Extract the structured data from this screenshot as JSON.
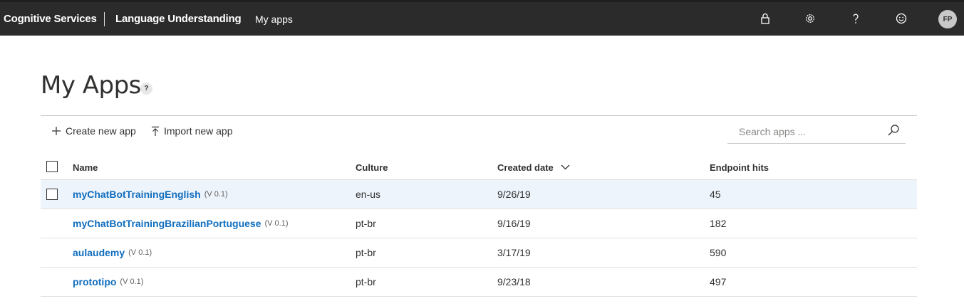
{
  "topbar": {
    "brand": "Cognitive Services",
    "product": "Language Understanding",
    "crumb": "My apps",
    "avatar_initials": "FP",
    "icons": [
      "lock-icon",
      "gear-icon",
      "help-icon",
      "smiley-icon"
    ]
  },
  "page": {
    "title": "My Apps",
    "help_glyph": "?"
  },
  "commands": {
    "create_label": "Create new app",
    "import_label": "Import new app"
  },
  "search": {
    "placeholder": "Search apps ...",
    "value": ""
  },
  "table": {
    "headers": {
      "name": "Name",
      "culture": "Culture",
      "created": "Created date",
      "hits": "Endpoint hits"
    },
    "sort": {
      "column": "created",
      "direction": "descending"
    },
    "rows": [
      {
        "name": "myChatBotTrainingEnglish",
        "version": "(V 0.1)",
        "culture": "en-us",
        "created": "9/26/19",
        "hits": "45",
        "selected": true
      },
      {
        "name": "myChatBotTrainingBrazilianPortuguese",
        "version": "(V 0.1)",
        "culture": "pt-br",
        "created": "9/16/19",
        "hits": "182",
        "selected": false
      },
      {
        "name": "aulaudemy",
        "version": "(V 0.1)",
        "culture": "pt-br",
        "created": "3/17/19",
        "hits": "590",
        "selected": false
      },
      {
        "name": "prototipo",
        "version": "(V 0.1)",
        "culture": "pt-br",
        "created": "9/23/18",
        "hits": "497",
        "selected": false
      }
    ]
  },
  "colors": {
    "topbar_bg": "#2b2b2b",
    "link": "#106ebe",
    "selected_row": "#eef4fb"
  }
}
